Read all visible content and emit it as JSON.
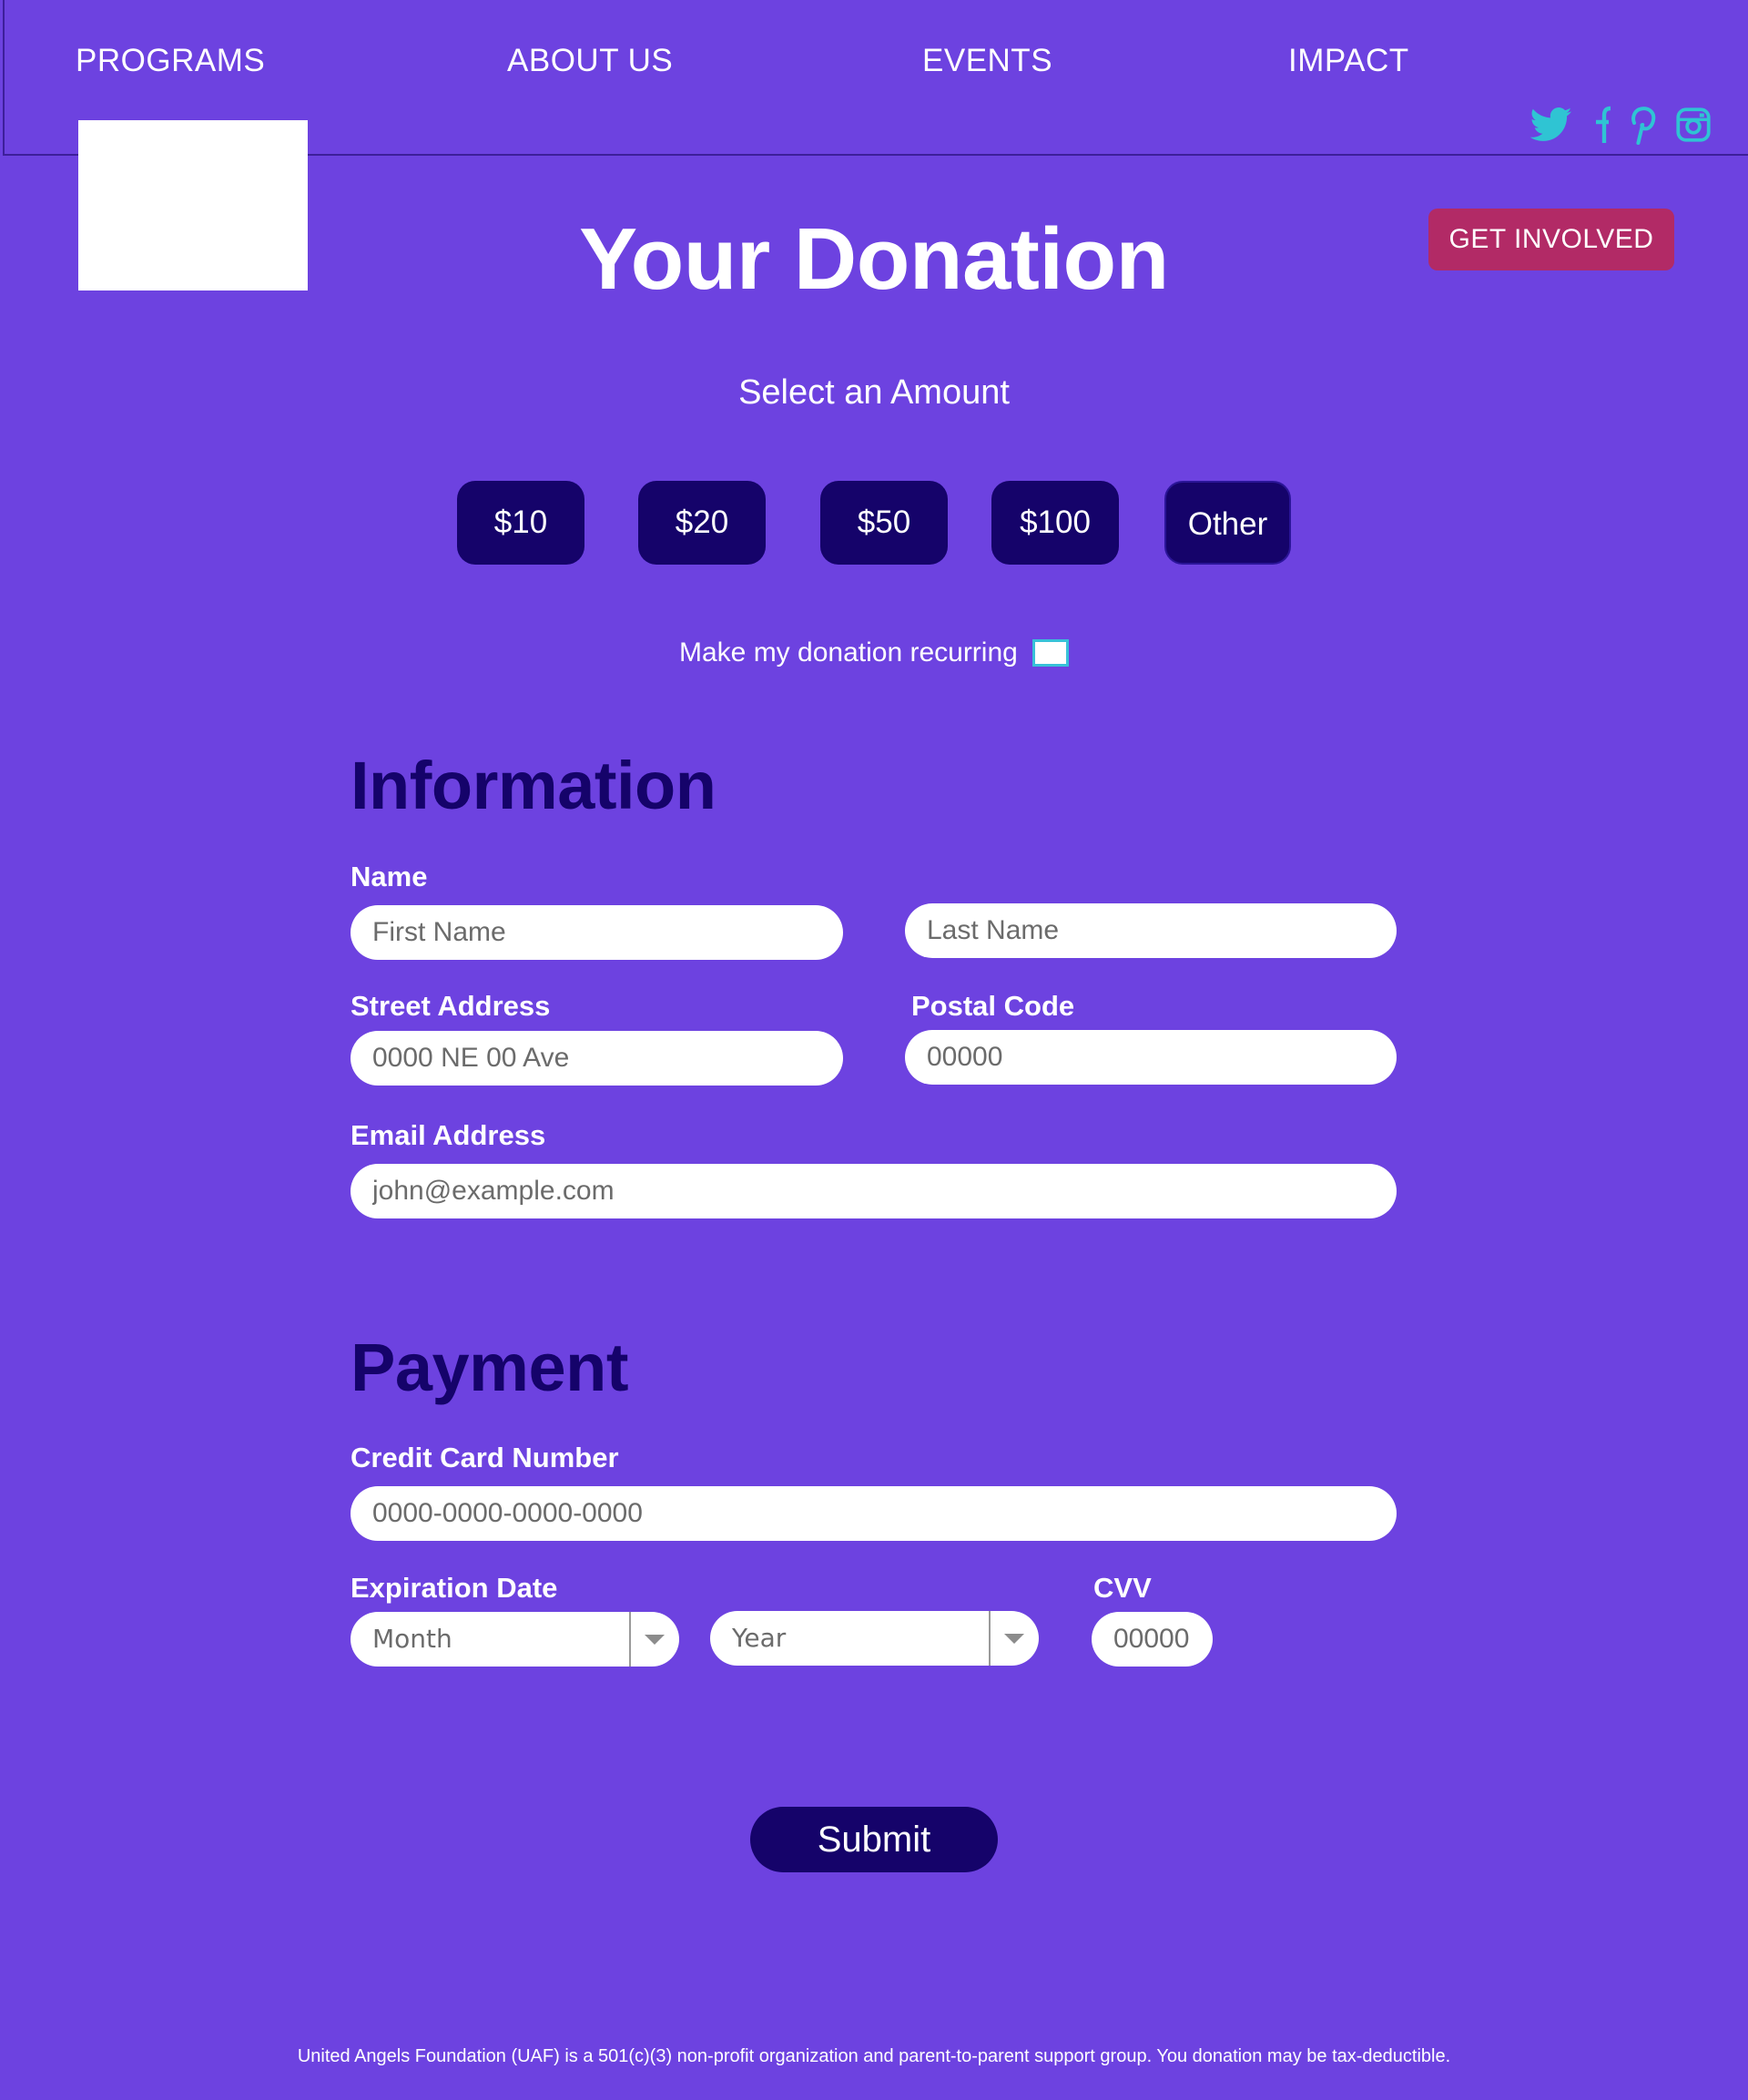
{
  "nav": {
    "items": [
      "PROGRAMS",
      "ABOUT US",
      "EVENTS",
      "IMPACT"
    ]
  },
  "social": {
    "icons": [
      "twitter-icon",
      "facebook-icon",
      "pinterest-icon",
      "instagram-icon"
    ],
    "color": "#2fc4d3"
  },
  "header": {
    "cta_label": "GET INVOLVED"
  },
  "hero": {
    "title": "Your Donation",
    "subtitle": "Select an Amount"
  },
  "amounts": {
    "options": [
      "$10",
      "$20",
      "$50",
      "$100",
      "Other"
    ]
  },
  "recurring": {
    "label": "Make my donation recurring"
  },
  "information": {
    "heading": "Information",
    "name_label": "Name",
    "first_name_placeholder": "First Name",
    "last_name_placeholder": "Last Name",
    "street_label": "Street Address",
    "street_placeholder": "0000 NE 00 Ave",
    "postal_label": "Postal Code",
    "postal_placeholder": "00000",
    "email_label": "Email Address",
    "email_placeholder": "john@example.com"
  },
  "payment": {
    "heading": "Payment",
    "card_label": "Credit Card Number",
    "card_placeholder": "0000-0000-0000-0000",
    "expiration_label": "Expiration Date",
    "month_value": "Month",
    "year_value": "Year",
    "cvv_label": "CVV",
    "cvv_placeholder": "00000"
  },
  "form": {
    "submit_label": "Submit"
  },
  "footer": {
    "note": "United Angels Foundation (UAF) is a 501(c)(3) non-profit organization and parent-to-parent support group. You donation may be tax-deductible."
  },
  "colors": {
    "background": "#6d42e0",
    "dark_navy": "#15036a",
    "cta_magenta": "#b22a66",
    "accent_teal": "#2fc4d3"
  }
}
